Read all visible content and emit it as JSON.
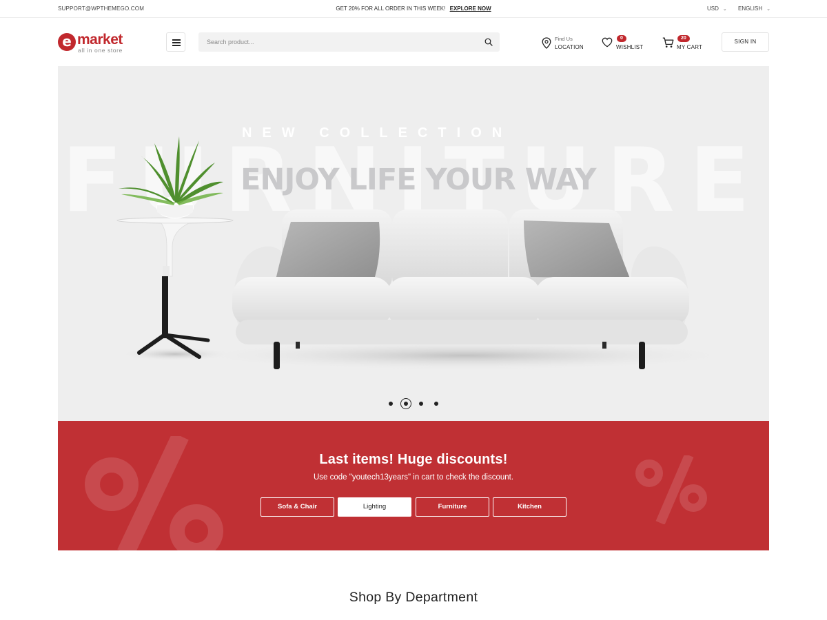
{
  "topbar": {
    "email": "SUPPORT@WPTHEMEGO.COM",
    "promo_text": "GET 20% FOR ALL ORDER IN THIS WEEK!",
    "promo_link": "EXPLORE NOW",
    "currency": "USD",
    "language": "ENGLISH"
  },
  "header": {
    "logo": {
      "wordmark": "market",
      "letter": "e",
      "tagline": "all in one store"
    },
    "search": {
      "placeholder": "Search product..."
    },
    "location": {
      "small": "Find Us",
      "label": "LOCATION"
    },
    "wishlist": {
      "label": "WISHLIST",
      "count": "0"
    },
    "cart": {
      "label": "MY CART",
      "count": "20"
    },
    "signin_label": "SIGN IN"
  },
  "hero": {
    "background_word": "FURNITURE",
    "kicker": "NEW COLLECTION",
    "headline": "ENJOY LIFE YOUR WAY",
    "slides": 4,
    "active_slide": 2
  },
  "discount": {
    "title": "Last items! Huge discounts!",
    "subtitle": "Use code \"youtech13years\" in cart to check the discount.",
    "categories": [
      "Sofa & Chair",
      "Lighting",
      "Furniture",
      "Kitchen"
    ],
    "active_category": "Lighting",
    "color": "#c03034"
  },
  "section": {
    "title": "Shop By Department"
  },
  "colors": {
    "brand": "#c1282d"
  }
}
